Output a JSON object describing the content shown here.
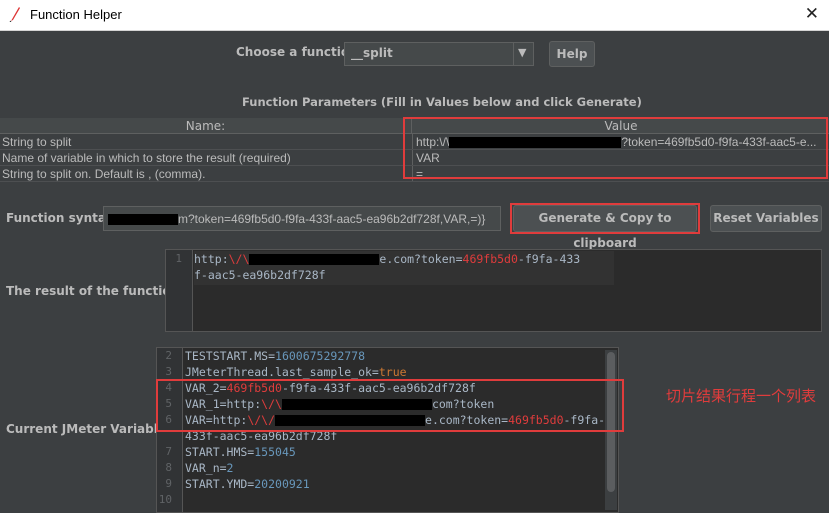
{
  "window": {
    "title": "Function Helper",
    "close_glyph": "✕"
  },
  "chooser": {
    "label": "Choose a function",
    "selected": "__split",
    "arrow": "▼",
    "help_label": "Help"
  },
  "params": {
    "title": "Function Parameters (Fill in Values below and click Generate)",
    "col_name": "Name:",
    "col_value": "Value",
    "rows": [
      {
        "name": "String to split",
        "value_prefix": "http:\\/\\",
        "value_suffix": "?token=469fb5d0-f9fa-433f-aac5-e..."
      },
      {
        "name": "Name of variable in which to store the result (required)",
        "value": "VAR"
      },
      {
        "name": "String to split on. Default is , (comma).",
        "value": "="
      }
    ]
  },
  "syntax": {
    "label": "Function syntax:",
    "value_suffix": "m?token=469fb5d0-f9fa-433f-aac5-ea96b2df728f,VAR,=)}",
    "generate_label": "Generate & Copy to clipboard",
    "reset_label": "Reset Variables"
  },
  "result": {
    "label": "The result of the function is",
    "line_number": "1",
    "line1_prefix": "http:",
    "line1_slash1": "\\/",
    "line1_slash2": "\\",
    "line1_mid": "e.com?token=",
    "line1_token": "469fb5d0",
    "line1_tail": "-f9fa-433",
    "line2": "f-aac5-ea96b2df728f"
  },
  "variables": {
    "label": "Current JMeter Variables",
    "lines": [
      {
        "n": "2",
        "key": "TESTSTART.MS=",
        "num": "1600675292778"
      },
      {
        "n": "3",
        "key": "JMeterThread.last_sample_ok=",
        "kw": "true"
      },
      {
        "n": "4",
        "key": "VAR_2=",
        "red": "469fb5d0",
        "rest": "-f9fa-433f-aac5-ea96b2df728f"
      },
      {
        "n": "5",
        "key": "VAR_1=http:",
        "red": "\\/\\",
        "rest": "com?token"
      },
      {
        "n": "6",
        "key": "VAR=http:",
        "red": "\\/\\/",
        "mid": "e.com?token=",
        "red2": "469fb5d0",
        "rest": "-f9fa-"
      },
      {
        "n": "",
        "wrap": "433f-aac5-ea96b2df728f"
      },
      {
        "n": "7",
        "key": "START.HMS=",
        "num": "155045"
      },
      {
        "n": "8",
        "key": "VAR_n=",
        "num": "2"
      },
      {
        "n": "9",
        "key": "START.YMD=",
        "num": "20200921"
      },
      {
        "n": "10",
        "key": ""
      }
    ]
  },
  "annotation": {
    "text": "切片结果行程一个列表"
  },
  "colors": {
    "accent_red": "#e03c3c",
    "bg": "#3c3f41",
    "editor_bg": "#2b2b2b"
  }
}
